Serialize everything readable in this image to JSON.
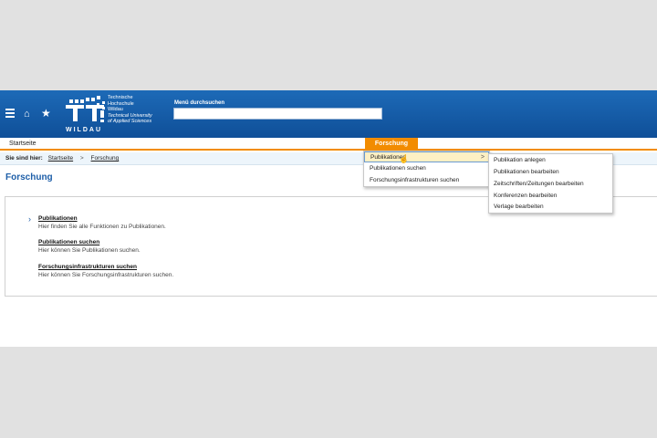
{
  "header": {
    "logo_word": "WILDAU",
    "logo_lines": [
      "Technische",
      "Hochschule",
      "Wildau",
      "Technical University",
      "of Applied Sciences"
    ],
    "search_label": "Menü durchsuchen",
    "search_value": ""
  },
  "nav": {
    "home_label": "Startseite",
    "active_label": "Forschung"
  },
  "breadcrumb": {
    "prefix": "Sie sind hier:",
    "items": [
      "Startseite",
      "Forschung"
    ],
    "separator": ">"
  },
  "page_title": "Forschung",
  "content": {
    "items": [
      {
        "title": "Publikationen",
        "desc": "Hier finden Sie alle Funktionen zu Publikationen."
      },
      {
        "title": "Publikationen suchen",
        "desc": "Hier können Sie Publikationen suchen."
      },
      {
        "title": "Forschungsinfrastrukturen suchen",
        "desc": "Hier können Sie Forschungsinfrastrukturen suchen."
      }
    ]
  },
  "dropdown": {
    "items": [
      "Publikationen",
      "Publikationen suchen",
      "Forschungsinfrastrukturen suchen"
    ],
    "arrow": ">"
  },
  "submenu": {
    "items": [
      "Publikation anlegen",
      "Publikationen bearbeiten",
      "Zeitschriften/Zeitungen bearbeiten",
      "Konferenzen bearbeiten",
      "Verlage bearbeiten"
    ]
  },
  "icons": {
    "menu": "hamburger-icon",
    "home": "home-icon",
    "favorites": "star-icon",
    "cursor": "mouse-cursor-icon"
  },
  "colors": {
    "header_blue": "#1d6ab7",
    "accent_orange": "#f28c00",
    "title_blue": "#1d5ea8"
  }
}
